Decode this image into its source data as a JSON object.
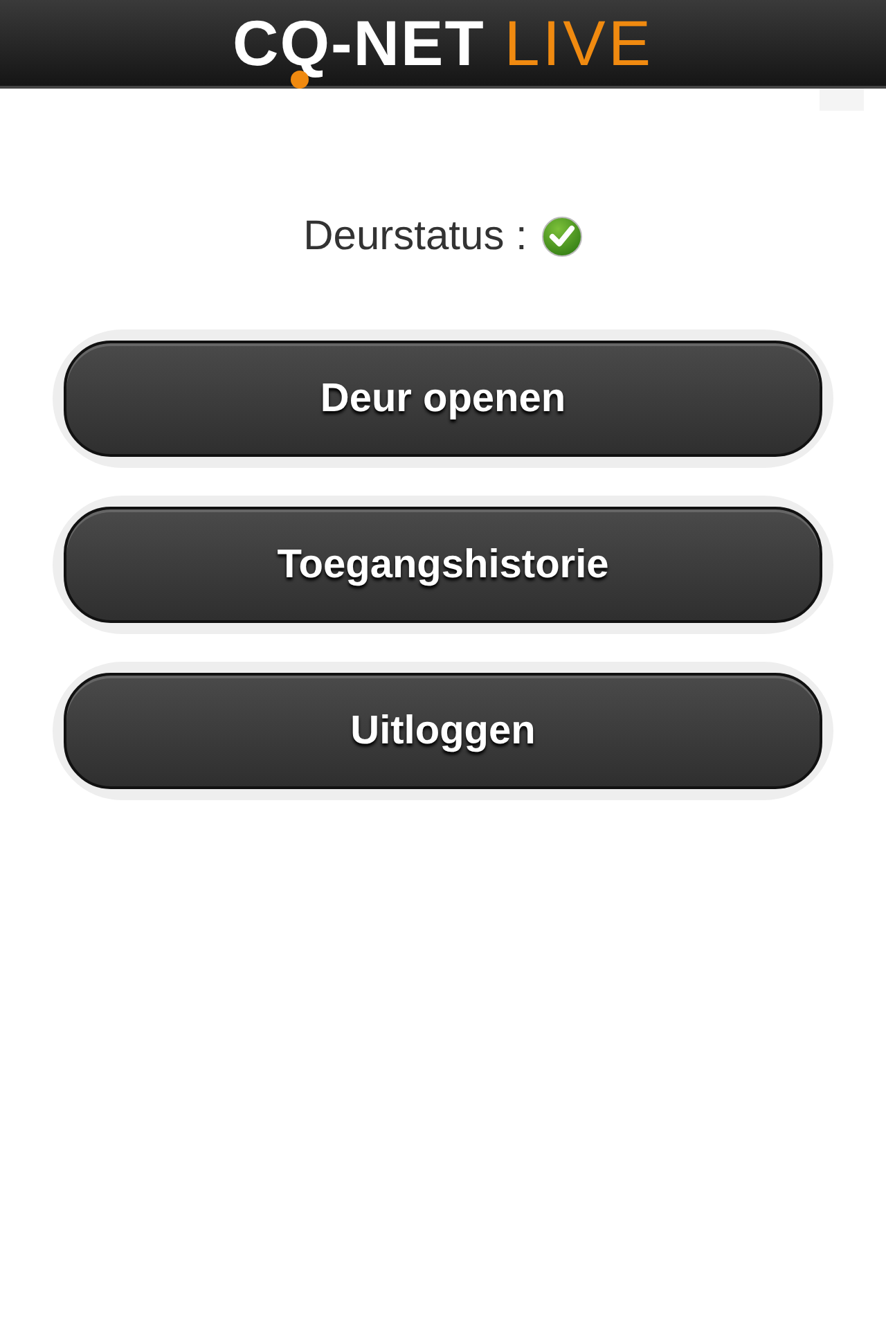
{
  "header": {
    "logo_primary": "CQ-NET",
    "logo_secondary": "LIVE"
  },
  "door_status": {
    "label": "Deurstatus :",
    "ok": true
  },
  "buttons": [
    {
      "label": "Deur openen"
    },
    {
      "label": "Toegangshistorie"
    },
    {
      "label": "Uitloggen"
    }
  ]
}
